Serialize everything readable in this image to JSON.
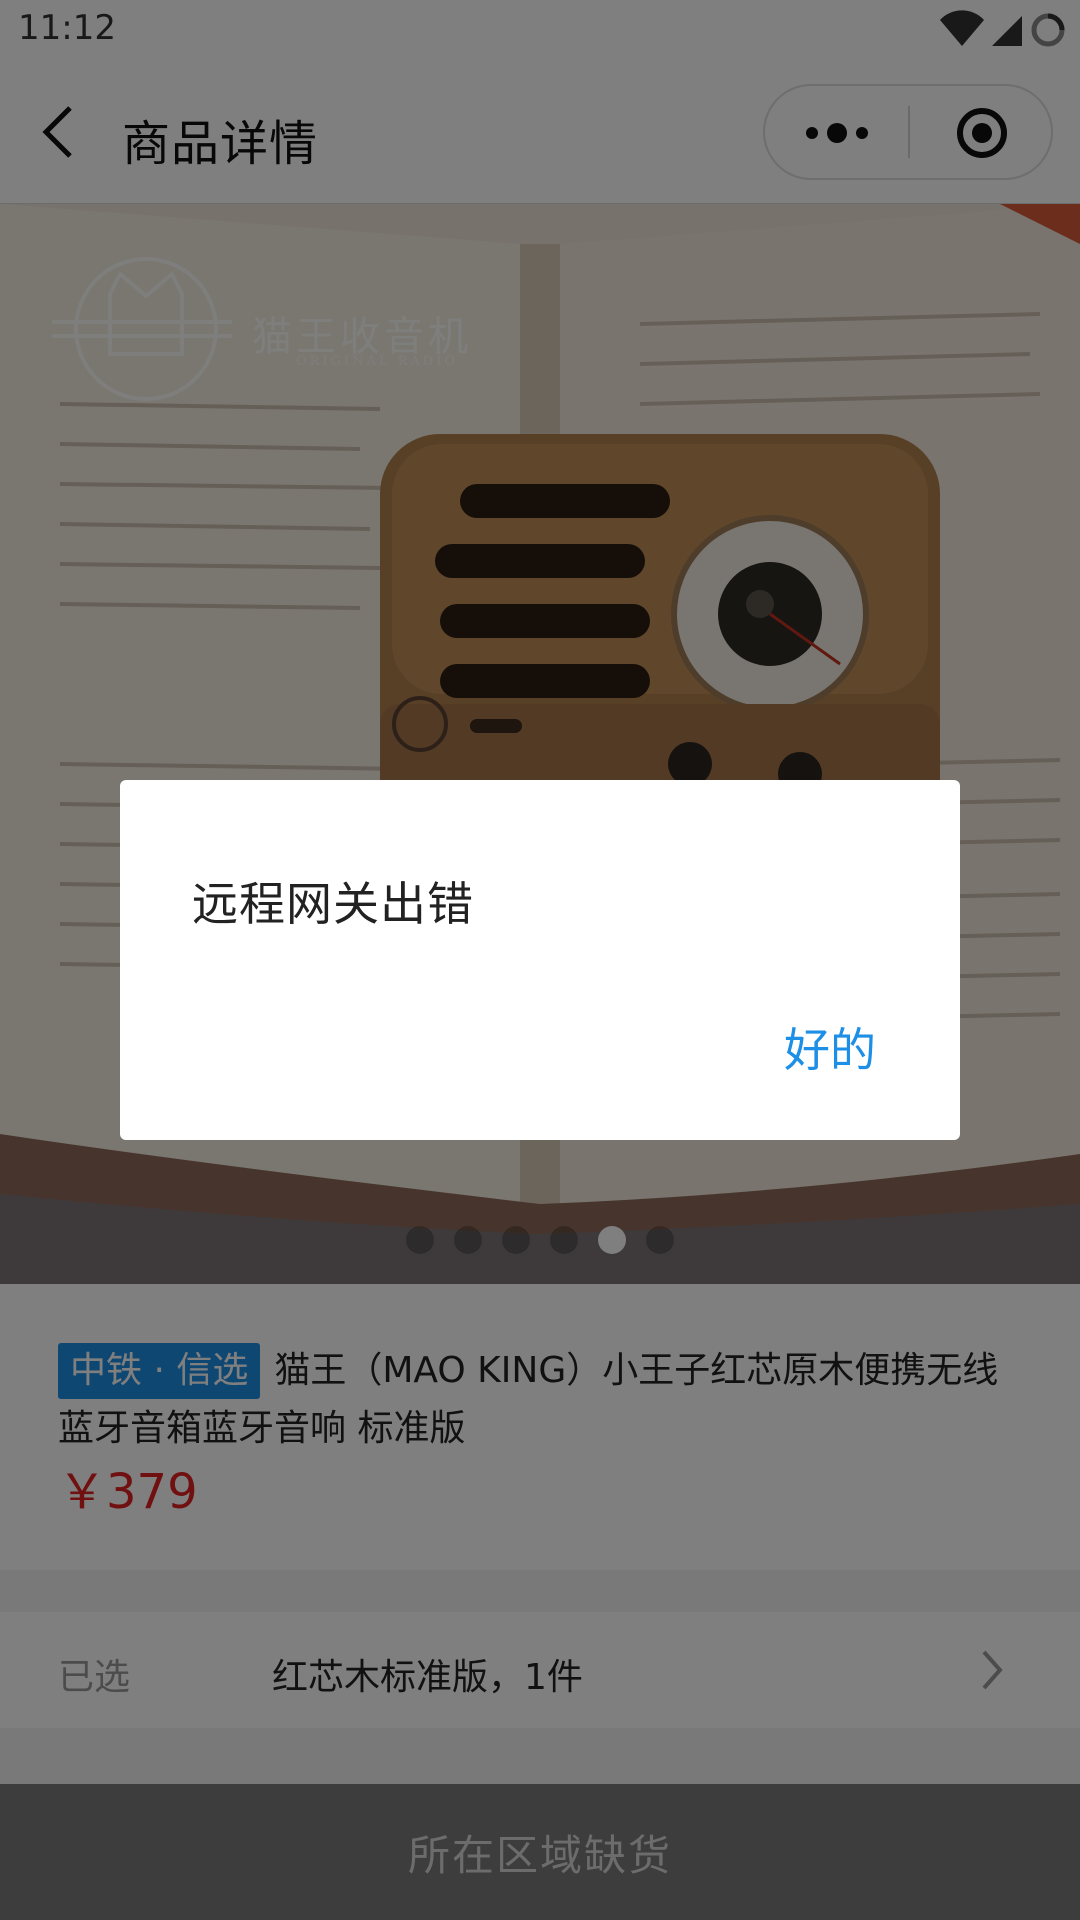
{
  "status_bar": {
    "time": "11:12",
    "icons": [
      "wifi-icon",
      "signal-icon",
      "loading-icon"
    ]
  },
  "nav": {
    "title": "商品详情",
    "back_icon": "chevron-left-icon",
    "more_icon": "more-dots-icon",
    "close_icon": "target-close-icon"
  },
  "hero": {
    "logo_text": "猫王收音机",
    "logo_sub": "ORIGINAL RADIO",
    "dot_count": 6,
    "active_dot": 5
  },
  "product": {
    "tag": "中铁 · 信选",
    "name": "猫王（MAO KING）小王子红芯原木便携无线蓝牙音箱蓝牙音响 标准版",
    "price": "￥379"
  },
  "selected": {
    "label": "已选",
    "value": "红芯木标准版，1件"
  },
  "bottom_bar": {
    "label": "所在区域缺货"
  },
  "dialog": {
    "message": "远程网关出错",
    "ok_label": "好的"
  },
  "colors": {
    "accent_blue": "#1e8fe6",
    "price_red": "#e02020",
    "mask": "rgba(0,0,0,0.5)"
  }
}
